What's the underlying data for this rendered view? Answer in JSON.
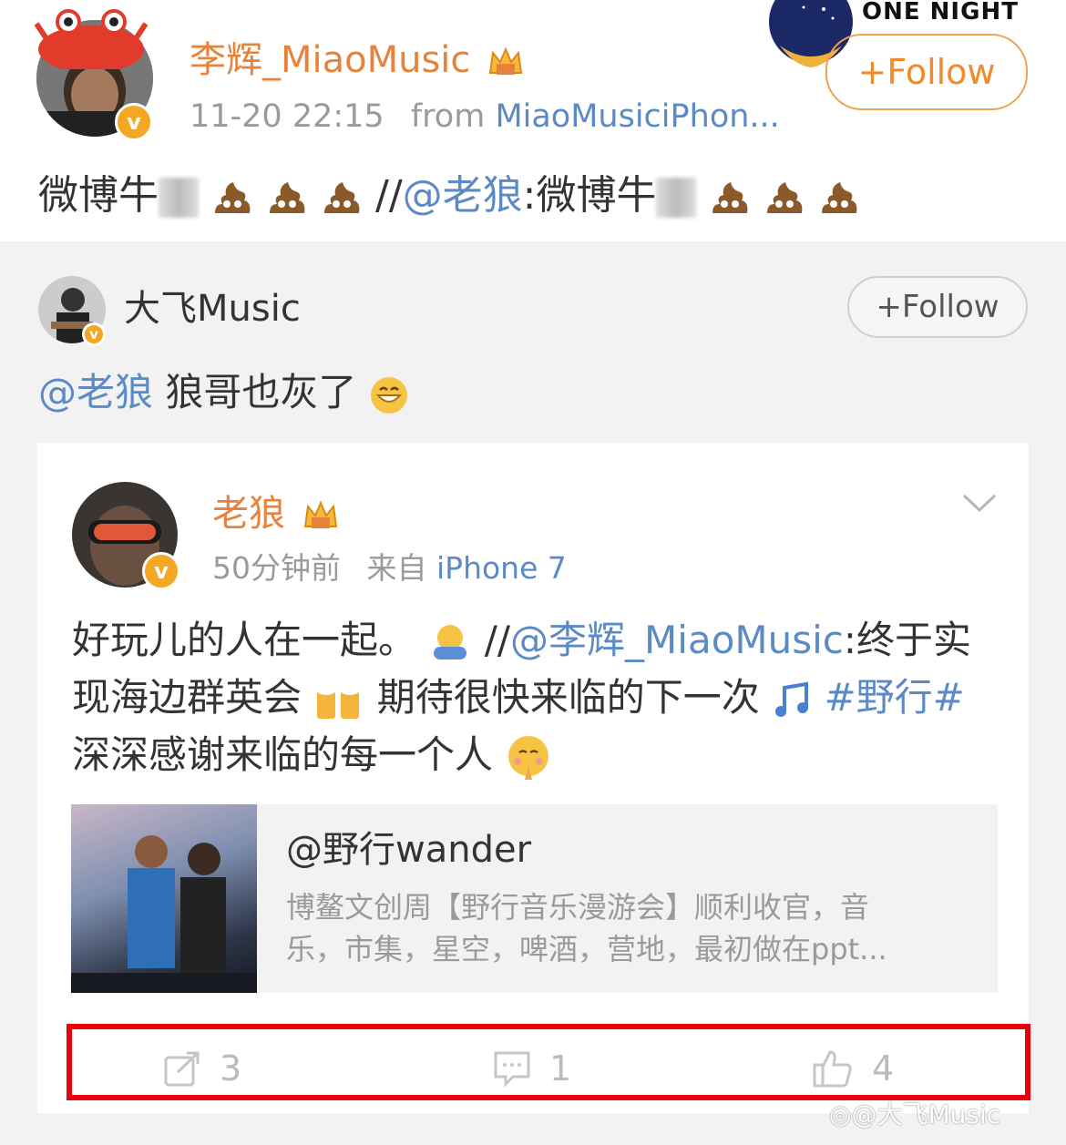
{
  "post": {
    "author": "李辉_MiaoMusic",
    "time": "11-20 22:15",
    "from_label": "from",
    "source": "MiaoMusiciPhon...",
    "follow_label": "Follow",
    "one_night_label": "ONE NIGHT",
    "text_prefix": "微博牛",
    "text_sep": "//",
    "mention": "@老狼",
    "text_colon": ":微博牛"
  },
  "retweet": {
    "author": "大飞Music",
    "follow_label": "Follow",
    "mention": "@老狼",
    "text": "狼哥也灰了"
  },
  "original": {
    "author": "老狼",
    "time": "50分钟前",
    "from_label": "来自",
    "source": "iPhone 7",
    "line1_text": "好玩儿的人在一起。",
    "line1_sep": "//",
    "line1_mention": "@李辉_MiaoMusic",
    "line1_tail": ":终于实",
    "line2_text": "现海边群英会",
    "line2_tail": "期待很快来临的下一次",
    "hashtag": "#野行#",
    "line3_text": "深深感谢来临的每一个人"
  },
  "link_card": {
    "title": "@野行wander",
    "desc_line1": "博鳌文创周【野行音乐漫游会】顺利收官，音",
    "desc_line2": "乐，市集，星空，啤酒，营地，最初做在ppt..."
  },
  "actions": {
    "repost_count": "3",
    "comment_count": "1",
    "like_count": "4"
  },
  "watermark": "@大飞Music",
  "colors": {
    "name": "#e8823a",
    "link": "#5b8ac4",
    "highlight": "#e8000b",
    "badge": "#f3a723"
  }
}
